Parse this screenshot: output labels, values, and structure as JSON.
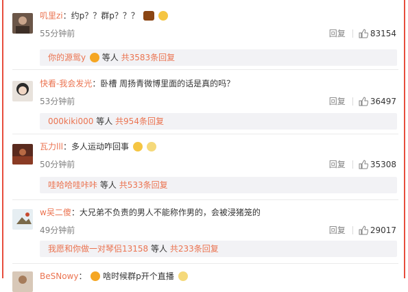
{
  "comments": [
    {
      "username": "叽里zi",
      "colon": "：",
      "text": "约p？？群p？？？",
      "time": "55分钟前",
      "reply_label": "回复",
      "likes": "83154",
      "sub": {
        "who": "你的源鸳y",
        "mid": "等人",
        "total": "共3583条回复"
      }
    },
    {
      "username": "快看-我会发光",
      "colon": "：",
      "text": "卧槽 周扬青微博里面的话是真的吗？",
      "time": "53分钟前",
      "reply_label": "回复",
      "likes": "36497",
      "sub": {
        "who": "000kiki000",
        "mid": "等人",
        "total": "共954条回复"
      }
    },
    {
      "username": "瓦力lll",
      "colon": "：",
      "text": "多人运动咋回事",
      "time": "50分钟前",
      "reply_label": "回复",
      "likes": "35308",
      "sub": {
        "who": "哇哈哈哇咔咔",
        "mid": "等人",
        "total": "共533条回复"
      }
    },
    {
      "username": "w吴二傻",
      "colon": "：",
      "text": "大兄弟不负责的男人不能称作男的，会被浸猪笼的",
      "time": "49分钟前",
      "reply_label": "回复",
      "likes": "29017",
      "sub": {
        "who": "我愿和你做一对琴侣13158",
        "mid": "等人",
        "total": "共233条回复"
      }
    },
    {
      "username": "BeSNowy",
      "colon": "：",
      "text": "啥时候群p开个直播"
    }
  ],
  "colors": {
    "accent": "#eb7350",
    "border": "#e74c3c",
    "subbg": "#f2f2f5"
  }
}
